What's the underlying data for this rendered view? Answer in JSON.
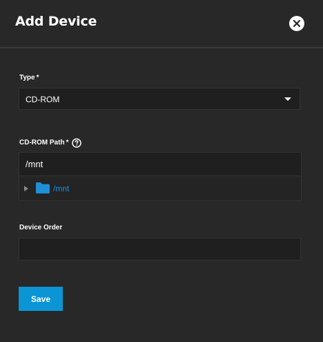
{
  "dialog": {
    "title": "Add Device",
    "close_icon": "close-icon"
  },
  "form": {
    "type": {
      "label": "Type",
      "required_mark": "*",
      "value": "CD-ROM",
      "arrow_icon": "chevron-down-icon"
    },
    "path": {
      "label": "CD-ROM Path",
      "required_mark": "*",
      "help_icon": "help-icon",
      "value": "/mnt",
      "tree": [
        {
          "label": "/mnt",
          "icon": "folder-icon",
          "expanded": false
        }
      ]
    },
    "order": {
      "label": "Device Order",
      "value": ""
    },
    "save_label": "Save"
  },
  "colors": {
    "background": "#282828",
    "input_bg": "#1f1f1f",
    "accent": "#0b95d4",
    "link": "#1e90d8"
  }
}
